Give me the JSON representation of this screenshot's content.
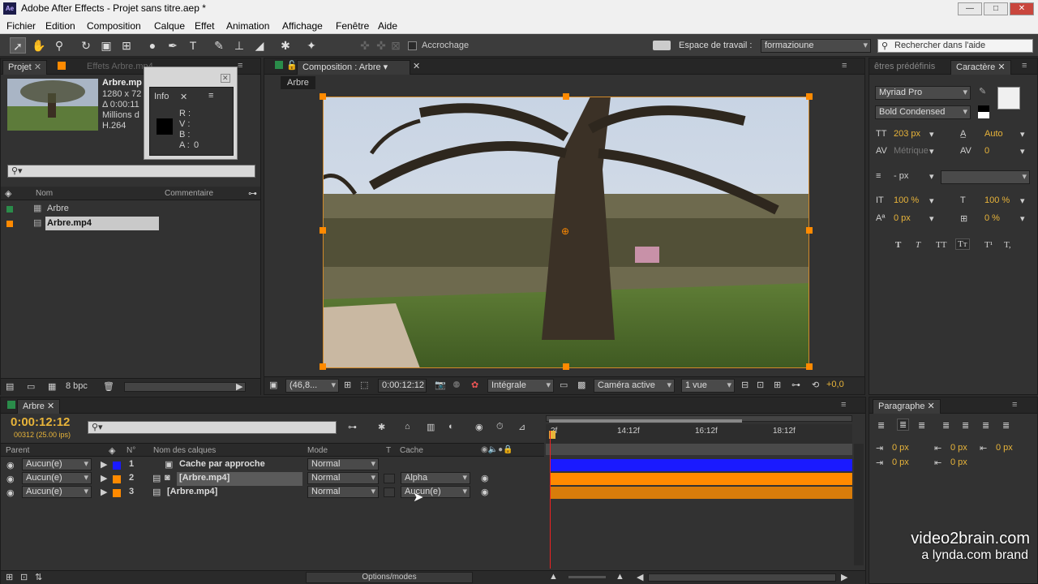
{
  "window": {
    "title": "Adobe After Effects - Projet sans titre.aep *",
    "app_icon": "Ae",
    "minimize": "—",
    "maximize": "□",
    "close": "✕"
  },
  "menu": [
    "Fichier",
    "Edition",
    "Composition",
    "Calque",
    "Effet",
    "Animation",
    "Affichage",
    "Fenêtre",
    "Aide"
  ],
  "toolbar": {
    "snap_label": "Accrochage",
    "workspace_label": "Espace de travail :",
    "workspace_value": "formazioune",
    "search_placeholder": "Rechercher dans l'aide"
  },
  "project": {
    "tab_project": "Projet",
    "tab_effects": "Effets Arbre.mp4",
    "footage": {
      "name": "Arbre.mp",
      "size": "1280 x 72",
      "duration": "Δ 0:00:11",
      "colors": "Millions d",
      "codec": "H.264"
    },
    "col_name": "Nom",
    "col_comment": "Commentaire",
    "items": [
      {
        "name": "Arbre"
      },
      {
        "name": "Arbre.mp4"
      }
    ],
    "bpc": "8 bpc"
  },
  "info": {
    "tab": "Info",
    "r": "R :",
    "v": "V :",
    "b": "B :",
    "a": "A :",
    "a_value": "0"
  },
  "comp": {
    "tab": "Composition : Arbre",
    "breadcrumb": "Arbre",
    "zoom": "(46,8...",
    "timecode": "0:00:12:12",
    "resolution": "Intégrale",
    "camera": "Caméra active",
    "views": "1 vue",
    "exposure": "+0,0"
  },
  "character": {
    "tab_presets": "êtres prédéfinis",
    "tab_char": "Caractère",
    "font": "Myriad Pro",
    "style": "Bold Condensed",
    "size": "203 px",
    "leading": "Auto",
    "kerning": "Métrique",
    "tracking": "0",
    "stroke": "- px",
    "vscale": "100 %",
    "hscale": "100 %",
    "baseline": "0 px",
    "tsume": "0 %",
    "styles": [
      "T",
      "T",
      "TT",
      "Tт",
      "T¹",
      "T,"
    ]
  },
  "paragraph": {
    "tab": "Paragraphe",
    "indent1": "0 px",
    "indent2": "0 px",
    "indent3": "0 px",
    "space1": "0 px",
    "space2": "0 px"
  },
  "timeline": {
    "tab": "Arbre",
    "timecode": "0:00:12:12",
    "fps": "00312 (25.00 ips)",
    "col_parent": "Parent",
    "col_num": "N°",
    "col_name": "Nom des calques",
    "col_mode": "Mode",
    "col_t": "T",
    "col_cache": "Cache",
    "ticks": [
      "2f",
      "14:12f",
      "16:12f",
      "18:12f"
    ],
    "layers": [
      {
        "parent": "Aucun(e)",
        "num": "1",
        "name": "Cache par approche",
        "mode": "Normal",
        "cache": "",
        "color": "#1a1aff"
      },
      {
        "parent": "Aucun(e)",
        "num": "2",
        "name": "[Arbre.mp4]",
        "mode": "Normal",
        "cache": "Alpha",
        "color": "#ff8a00"
      },
      {
        "parent": "Aucun(e)",
        "num": "3",
        "name": "[Arbre.mp4]",
        "mode": "Normal",
        "cache": "Aucun(e)",
        "color": "#ff8a00"
      }
    ],
    "options": "Options/modes"
  },
  "watermark": {
    "line1": "video2brain.com",
    "line2": "a lynda.com brand"
  }
}
